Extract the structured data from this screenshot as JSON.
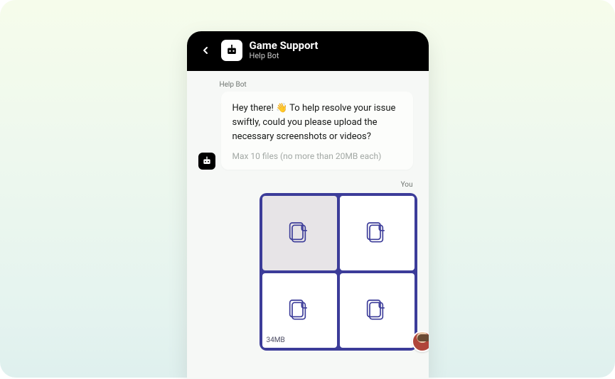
{
  "header": {
    "title": "Game Support",
    "subtitle": "Help Bot"
  },
  "chat": {
    "bot_sender_label": "Help Bot",
    "bot_bubble": {
      "message": "Hey there! 👋 To help resolve your issue swiftly, could you please upload the necessary screenshots or videos?",
      "hint": "Max 10 files (no more than 20MB each)"
    },
    "you_label": "You",
    "upload": {
      "accent_color": "#3c3c99",
      "tiles": [
        {
          "shaded": true
        },
        {
          "shaded": false
        },
        {
          "shaded": false,
          "size_label": "34MB"
        },
        {
          "shaded": false
        }
      ]
    }
  }
}
